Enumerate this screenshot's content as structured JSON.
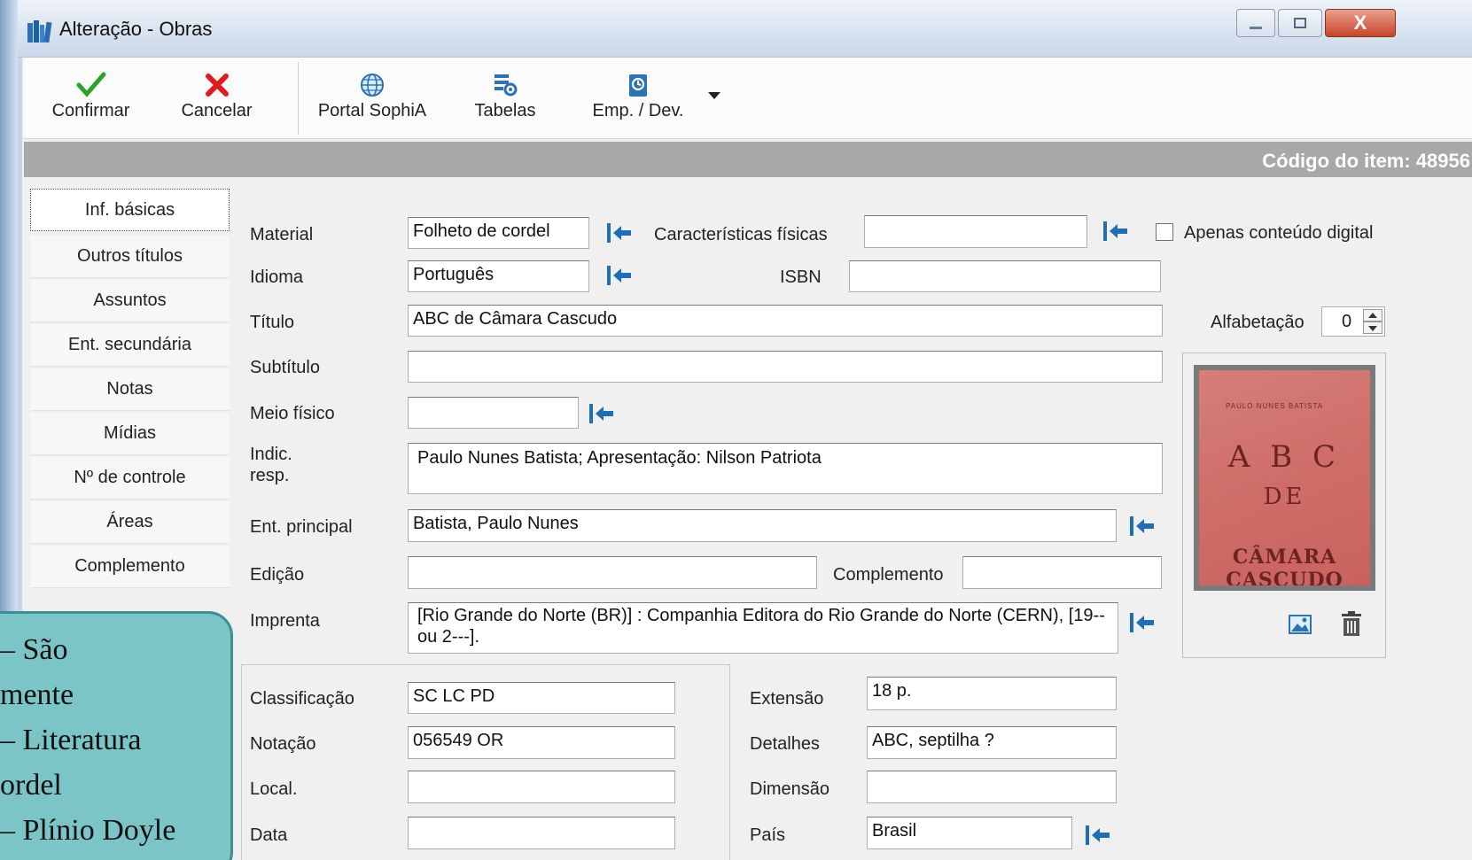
{
  "window": {
    "title": "Alteração - Obras",
    "close_glyph": "X"
  },
  "toolbar": {
    "confirm_label": "Confirmar",
    "cancel_label": "Cancelar",
    "portal_label": "Portal SophiA",
    "tables_label": "Tabelas",
    "loan_label": "Emp. / Dev."
  },
  "code_bar": {
    "text": "Código do item: 48956"
  },
  "sidebar": {
    "items": [
      {
        "label": "Inf. básicas",
        "active": true
      },
      {
        "label": "Outros títulos"
      },
      {
        "label": "Assuntos"
      },
      {
        "label": "Ent. secundária"
      },
      {
        "label": "Notas"
      },
      {
        "label": "Mídias"
      },
      {
        "label": "Nº de controle"
      },
      {
        "label": "Áreas"
      },
      {
        "label": "Complemento"
      }
    ]
  },
  "form": {
    "material": {
      "label": "Material",
      "value": "Folheto de cordel"
    },
    "caracteristicas": {
      "label": "Características físicas",
      "value": ""
    },
    "apenas_digital": {
      "label": "Apenas conteúdo digital",
      "checked": false
    },
    "idioma": {
      "label": "Idioma",
      "value": "Português"
    },
    "isbn": {
      "label": "ISBN",
      "value": ""
    },
    "titulo": {
      "label": "Título",
      "value": "ABC de Câmara Cascudo"
    },
    "alfabetacao": {
      "label": "Alfabetação",
      "value": "0"
    },
    "subtitulo": {
      "label": "Subtítulo",
      "value": ""
    },
    "meio_fisico": {
      "label": "Meio físico",
      "value": ""
    },
    "indic_resp": {
      "label_line1": "Indic.",
      "label_line2": "resp.",
      "value": "Paulo Nunes Batista; Apresentação: Nilson Patriota"
    },
    "ent_principal": {
      "label": "Ent. principal",
      "value": "Batista, Paulo Nunes"
    },
    "edicao": {
      "label": "Edição",
      "value": ""
    },
    "complemento": {
      "label": "Complemento",
      "value": ""
    },
    "imprenta": {
      "label": "Imprenta",
      "value": "[Rio Grande do Norte (BR)] : Companhia Editora do Rio Grande do Norte (CERN), [19-- ou 2---]."
    },
    "classificacao": {
      "label": "Classificação",
      "value": "SC LC PD"
    },
    "notacao": {
      "label": "Notação",
      "value": "056549 OR"
    },
    "local": {
      "label": "Local.",
      "value": ""
    },
    "data": {
      "label": "Data",
      "value": ""
    },
    "extensao": {
      "label": "Extensão",
      "value": "18 p."
    },
    "detalhes": {
      "label": "Detalhes",
      "value": "ABC, septilha ?"
    },
    "dimensao": {
      "label": "Dimensão",
      "value": ""
    },
    "pais": {
      "label": "País",
      "value": "Brasil"
    }
  },
  "cover": {
    "top_text": "PAULO NUNES BATISTA",
    "line1": "A B C",
    "line2": "DE",
    "line3": "CÂMARA CASCUDO"
  },
  "overlay_note": {
    "text": "– São\nmente\n– Literatura\nordel\n– Plínio Doyle"
  },
  "colors": {
    "code_bar": "#a8a8a8",
    "confirm": "#2aa32a",
    "cancel": "#e01b1b",
    "overlay": "#7cc5c7",
    "arrow_icon": "#1f6fb6"
  }
}
